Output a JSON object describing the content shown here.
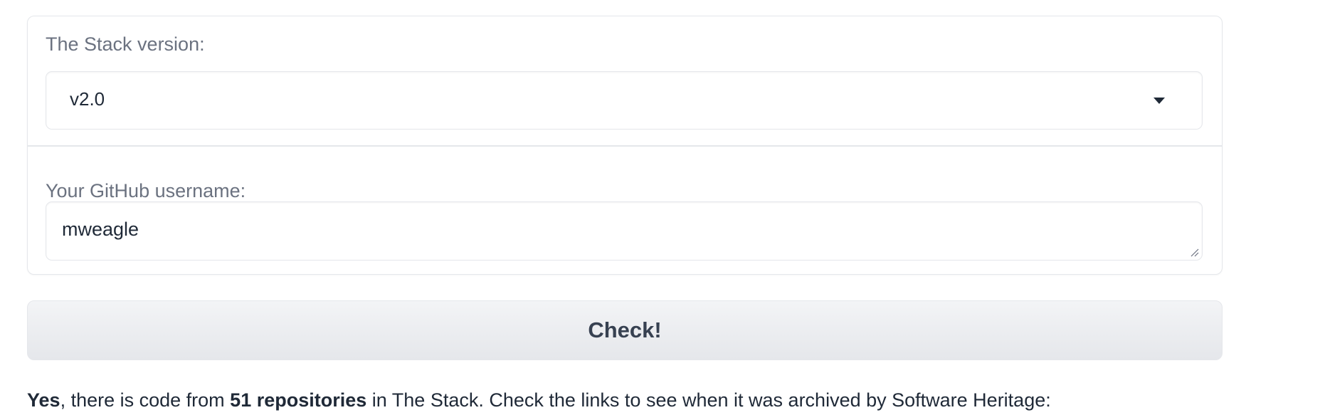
{
  "form": {
    "version_label": "The Stack version:",
    "version_value": "v2.0",
    "username_label": "Your GitHub username:",
    "username_value": "mweagle"
  },
  "actions": {
    "check_label": "Check!"
  },
  "result": {
    "yes": "Yes",
    "text_1": ", there is code from ",
    "repo_count": "51 repositories",
    "text_2": " in The Stack. Check the links to see when it was archived by Software Heritage:"
  },
  "icons": {
    "select_caret": "chevron-down-icon",
    "textarea_resize": "resize-handle-icon"
  },
  "colors": {
    "label": "#6b7280",
    "text": "#1f2937",
    "border": "#e5e7eb",
    "button_bg": "#e5e7eb"
  }
}
